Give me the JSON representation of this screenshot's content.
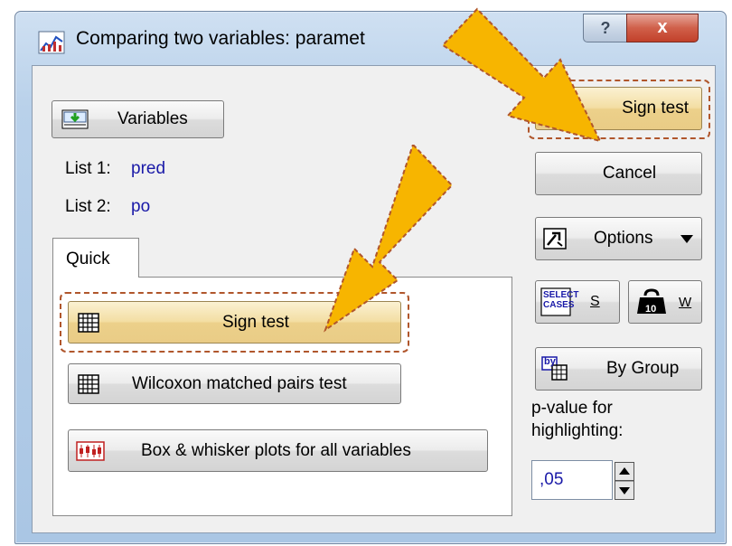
{
  "window": {
    "title": "Comparing two variables: paramet",
    "help_glyph": "?",
    "close_glyph": "x"
  },
  "left": {
    "variables_button": "Variables",
    "list1_label": "List 1:",
    "list1_value": "pred",
    "list2_label": "List 2:",
    "list2_value": "po",
    "tab_quick": "Quick",
    "sign_test_button": "Sign test",
    "wilcoxon_button": "Wilcoxon matched pairs test",
    "boxplot_button": "Box & whisker plots for all variables"
  },
  "right": {
    "sign_test_button": "Sign test",
    "cancel_button": "Cancel",
    "options_button": "Options",
    "select_cases_icon_text": "SELECT CASES",
    "select_cases_shortcut": "S",
    "weight_shortcut": "W",
    "weight_icon_text": "10",
    "by_group_button": "By Group",
    "by_group_icon_text": "by",
    "pvalue_label_line1": "p-value for",
    "pvalue_label_line2": "highlighting:",
    "pvalue_value": ",05"
  },
  "colors": {
    "highlight": "#f3dea3",
    "arrow": "#f7b500",
    "dashed_outline": "#b0562c",
    "value_text": "#1a1aa8"
  }
}
